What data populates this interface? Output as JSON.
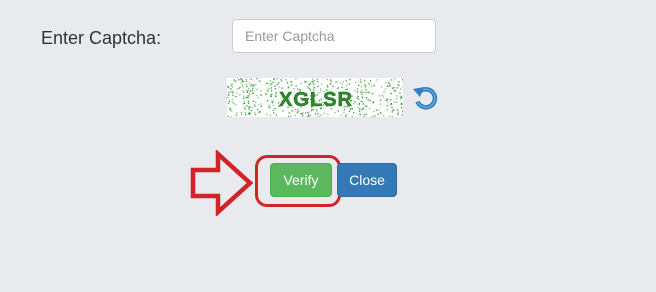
{
  "form": {
    "label": "Enter Captcha:",
    "input_value": "",
    "input_placeholder": "Enter Captcha"
  },
  "captcha": {
    "text": "XGLSR",
    "text_color": "#2e8a2e"
  },
  "icons": {
    "refresh": "refresh-icon",
    "arrow": "arrow-right-outline-icon"
  },
  "buttons": {
    "verify_label": "Verify",
    "close_label": "Close"
  },
  "colors": {
    "background": "#e9eaed",
    "verify": "#5cb85c",
    "close": "#337ab7",
    "highlight": "#d1242a",
    "refresh": "#2f7fc1"
  }
}
